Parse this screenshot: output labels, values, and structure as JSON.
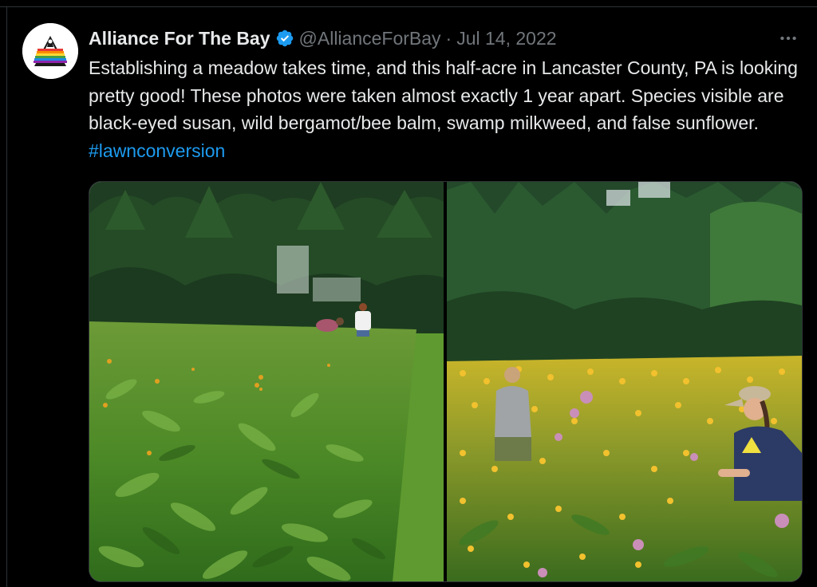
{
  "tweet": {
    "author_name": "Alliance For The Bay",
    "handle": "@AllianceForBay",
    "separator": "·",
    "date": "Jul 14, 2022",
    "text_main": "Establishing a meadow takes time, and this half-acre in Lancaster County, PA is looking pretty good! These photos were taken almost exactly 1 year apart. Species visible are black-eyed susan, wild bergamot/bee balm, swamp milkweed, and false sunflower. ",
    "hashtag": "#lawnconversion",
    "icons": {
      "avatar": "alliance-logo-icon",
      "verified": "verified-badge-icon",
      "more": "more-options-icon"
    },
    "colors": {
      "background": "#000000",
      "text": "#e7e9ea",
      "muted": "#71767b",
      "link": "#1d9bf0",
      "verified": "#1d9bf0"
    }
  }
}
